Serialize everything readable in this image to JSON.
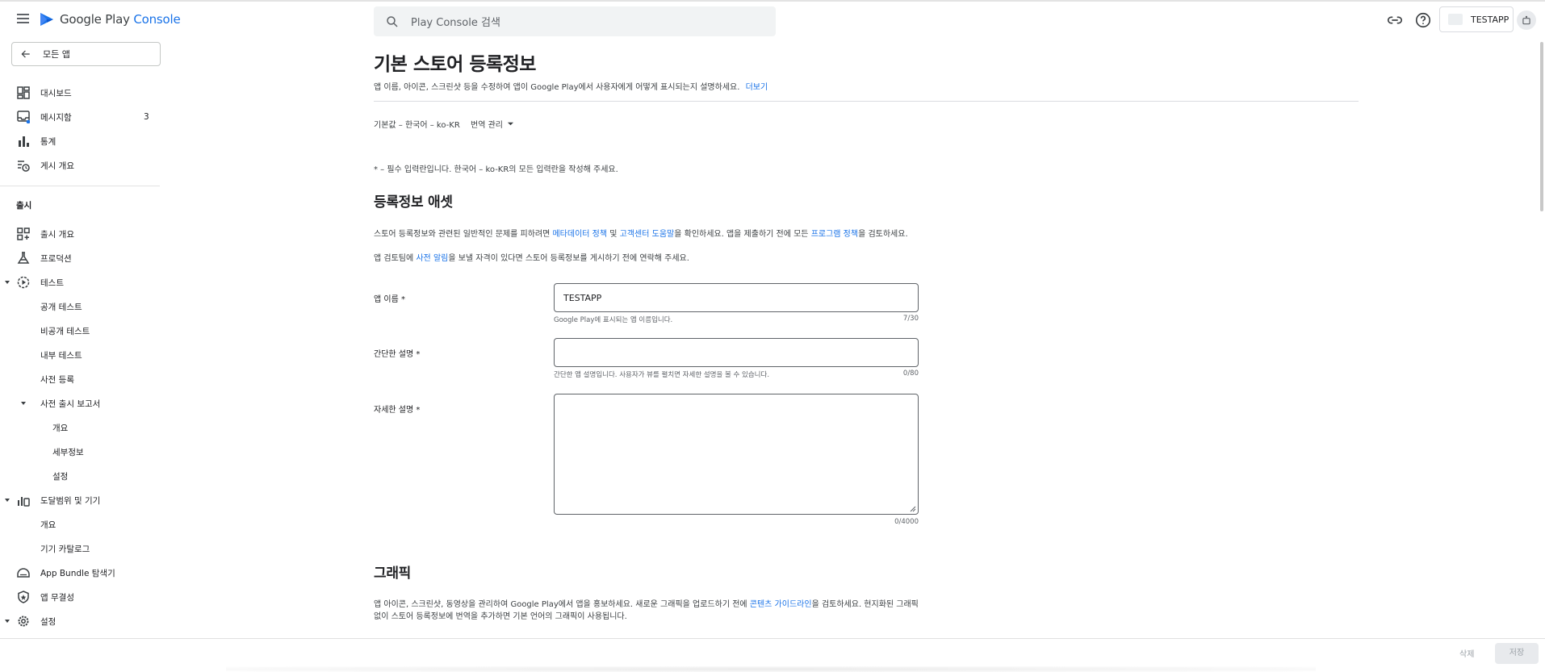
{
  "header": {
    "logo_text_main": "Google Play",
    "logo_text_accent": "Console",
    "search_placeholder": "Play Console 검색",
    "app_name": "TESTAPP",
    "accent_color": "#1a73e8"
  },
  "sidebar": {
    "back_label": "모든 앱",
    "items_top": [
      {
        "label": "대시보드",
        "icon": "dashboard-icon"
      },
      {
        "label": "메시지함",
        "icon": "inbox-icon",
        "count": "3"
      },
      {
        "label": "통계",
        "icon": "bar-chart-icon"
      },
      {
        "label": "게시 개요",
        "icon": "publishing-overview-icon"
      }
    ],
    "section_release": "출시",
    "items_release": [
      {
        "label": "출시 개요",
        "icon": "release-overview-icon"
      },
      {
        "label": "프로덕션",
        "icon": "production-icon"
      },
      {
        "label": "테스트",
        "icon": "testing-icon"
      },
      {
        "label": "공개 테스트"
      },
      {
        "label": "비공개 테스트"
      },
      {
        "label": "내부 테스트"
      },
      {
        "label": "사전 등록"
      },
      {
        "label": "사전 출시 보고서"
      },
      {
        "label": "개요"
      },
      {
        "label": "세부정보"
      },
      {
        "label": "설정"
      },
      {
        "label": "도달범위 및 기기",
        "icon": "reach-devices-icon"
      },
      {
        "label": "개요"
      },
      {
        "label": "기기 카탈로그"
      },
      {
        "label": "App Bundle 탐색기",
        "icon": "app-bundle-icon"
      },
      {
        "label": "앱 무결성",
        "icon": "app-integrity-icon"
      },
      {
        "label": "설정",
        "icon": "settings-icon"
      }
    ]
  },
  "main": {
    "title": "기본 스토어 등록정보",
    "subtitle": "앱 이름, 아이콘, 스크린샷 등을 수정하여 앱이 Google Play에서 사용자에게 어떻게 표시되는지 설명하세요.",
    "subtitle_link": "더보기",
    "language": "기본값 – 한국어 – ko-KR",
    "translation_label": "번역 관리",
    "required_note": "* – 필수 입력란입니다. 한국어 – ko-KR의 모든 입력란을 작성해 주세요.",
    "assets_heading": "등록정보 애셋",
    "assets_para1_a": "스토어 등록정보와 관련된 일반적인 문제를 피하려면 ",
    "assets_para1_link1": "메타데이터 정책",
    "assets_para1_b": " 및 ",
    "assets_para1_link2": "고객센터 도움말",
    "assets_para1_c": "을 확인하세요. 앱을 제출하기 전에 모든 ",
    "assets_para1_link3": "프로그램 정책",
    "assets_para1_d": "을 검토하세요.",
    "assets_para2_a": "앱 검토팀에 ",
    "assets_para2_link": "사전 알림",
    "assets_para2_b": "을 보낼 자격이 있다면 스토어 등록정보를 게시하기 전에 연락해 주세요.",
    "fields": {
      "app_name_label": "앱 이름 *",
      "app_name_value": "TESTAPP",
      "app_name_helper": "Google Play에 표시되는 앱 이름입니다.",
      "app_name_counter": "7/30",
      "short_desc_label": "간단한 설명 *",
      "short_desc_value": "",
      "short_desc_helper": "간단한 앱 설명입니다. 사용자가 뷰를 펼치면 자세한 설명을 볼 수 있습니다.",
      "short_desc_counter": "0/80",
      "full_desc_label": "자세한 설명 *",
      "full_desc_value": "",
      "full_desc_counter": "0/4000"
    },
    "graphics_heading": "그래픽",
    "graphics_para_a": "앱 아이콘, 스크린샷, 동영상을 관리하여 Google Play에서 앱을 홍보하세요. 새로운 그래픽을 업로드하기 전에 ",
    "graphics_para_link": "콘텐츠 가이드라인",
    "graphics_para_b": "을 검토하세요. 현지화된 그래픽",
    "graphics_para_line2": "없이 스토어 등록정보에 번역을 추가하면 기본 언어의 그래픽이 사용됩니다."
  },
  "footer": {
    "delete_label": "삭제",
    "save_label": "저장"
  }
}
